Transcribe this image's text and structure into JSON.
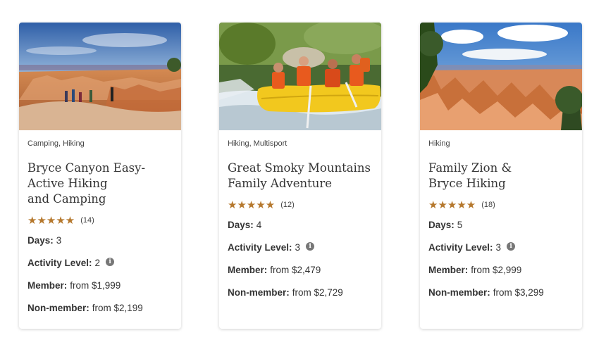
{
  "cards": [
    {
      "tags": "Camping, Hiking",
      "title_lines": [
        "Bryce Canyon Easy-",
        "Active Hiking",
        "and Camping"
      ],
      "stars": "★★★★★",
      "review_count": "(14)",
      "days_label": "Days:",
      "days_value": "3",
      "activity_label": "Activity Level:",
      "activity_value": "2",
      "info_icon": "i",
      "member_label": "Member:",
      "member_value": "from $1,999",
      "nonmember_label": "Non-member:",
      "nonmember_value": "from $2,199"
    },
    {
      "tags": "Hiking, Multisport",
      "title_lines": [
        "Great Smoky Mountains",
        "Family Adventure"
      ],
      "stars": "★★★★★",
      "review_count": "(12)",
      "days_label": "Days:",
      "days_value": "4",
      "activity_label": "Activity Level:",
      "activity_value": "3",
      "info_icon": "i",
      "member_label": "Member:",
      "member_value": "from $2,479",
      "nonmember_label": "Non-member:",
      "nonmember_value": "from $2,729"
    },
    {
      "tags": "Hiking",
      "title_lines": [
        "Family Zion &",
        "Bryce Hiking"
      ],
      "stars": "★★★★★",
      "review_count": "(18)",
      "days_label": "Days:",
      "days_value": "5",
      "activity_label": "Activity Level:",
      "activity_value": "3",
      "info_icon": "i",
      "member_label": "Member:",
      "member_value": "from $2,999",
      "nonmember_label": "Non-member:",
      "nonmember_value": "from $3,299"
    }
  ],
  "colors": {
    "star": "#b5782d",
    "text": "#333333",
    "info_icon_bg": "#777777"
  }
}
